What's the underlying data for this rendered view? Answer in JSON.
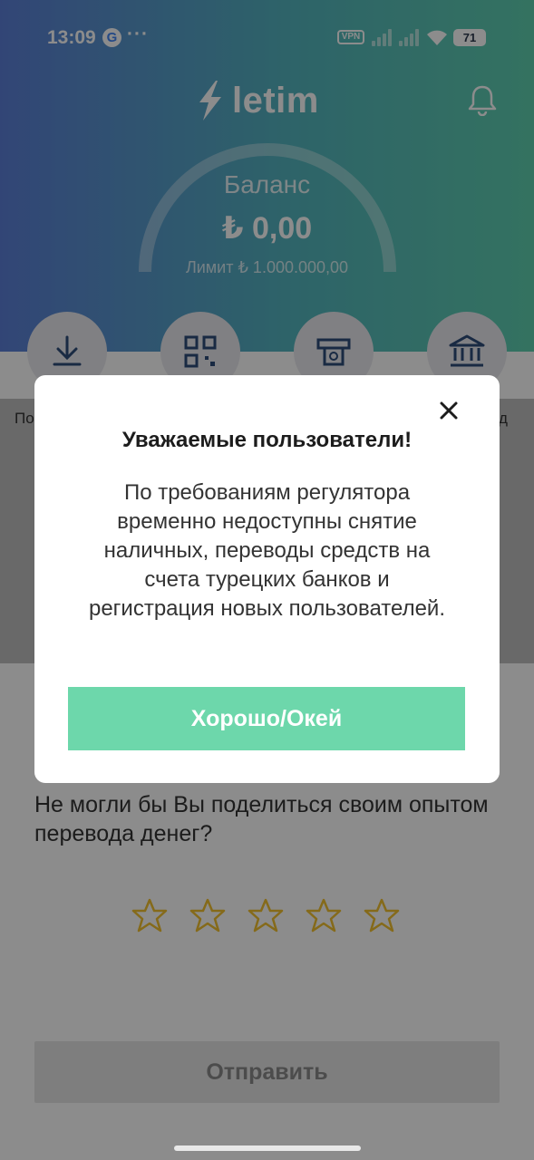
{
  "status_bar": {
    "time": "13:09",
    "google_icon": "google-icon",
    "overflow": "···",
    "vpn_label": "VPN",
    "battery_level": "71"
  },
  "header": {
    "brand_name": "letim",
    "notification_icon": "bell-icon"
  },
  "balance": {
    "title": "Баланс",
    "amount": "₺ 0,00",
    "limit_text": "Лимит  ₺ 1.000.000,00"
  },
  "actions": [
    {
      "icon": "download-icon",
      "label": "По"
    },
    {
      "icon": "qr-code-icon",
      "label": ""
    },
    {
      "icon": "atm-icon",
      "label": ""
    },
    {
      "icon": "bank-icon",
      "label": "д"
    }
  ],
  "feedback": {
    "question": "Не могли бы Вы поделиться своим опытом перевода денег?",
    "rating": 0,
    "max_rating": 5,
    "submit_label": "Отправить"
  },
  "modal": {
    "title": "Уважаемые пользователи!",
    "body": "По требованиям регулятора временно недоступны снятие наличных, переводы средств на счета турецких банков и регистрация новых пользователей.",
    "ok_label": "Хорошо/Окей"
  },
  "colors": {
    "accent": "#6dd7ab",
    "gradient_start": "#5b7fd8",
    "gradient_end": "#5fd0b0",
    "star": "#f2c230"
  }
}
